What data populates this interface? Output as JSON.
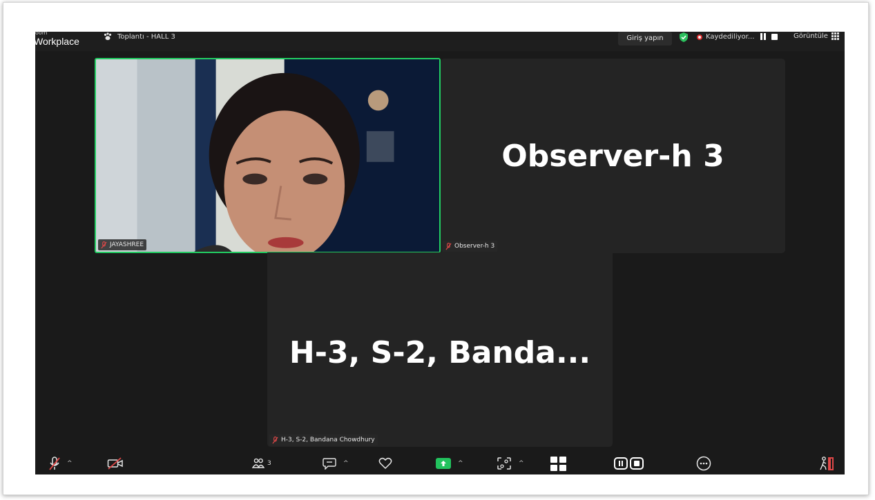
{
  "titlebar": {
    "brand_small": "oom",
    "brand": "Workplace",
    "meeting_title": "Toplantı - HALL 3",
    "signin_label": "Giriş yapın",
    "recording_label": "Kaydediliyor...",
    "view_label": "Görüntüle"
  },
  "participants": [
    {
      "name": "JAYASHREE",
      "muted": true,
      "video_on": true
    },
    {
      "name": "Observer-h 3",
      "display_text": "Observer-h 3",
      "muted": true,
      "video_on": false
    },
    {
      "name": "H-3, S-2, Bandana Chowdhury",
      "display_text": "H-3, S-2, Banda...",
      "muted": true,
      "video_on": false
    }
  ],
  "toolbar": {
    "participants_count": "3",
    "mic_state": "muted",
    "video_state": "off"
  },
  "colors": {
    "active_speaker_border": "#22cf63",
    "share_button": "#22c35e",
    "recording_dot": "#e02f2f",
    "background": "#1a1a1a",
    "tile": "#242424"
  }
}
